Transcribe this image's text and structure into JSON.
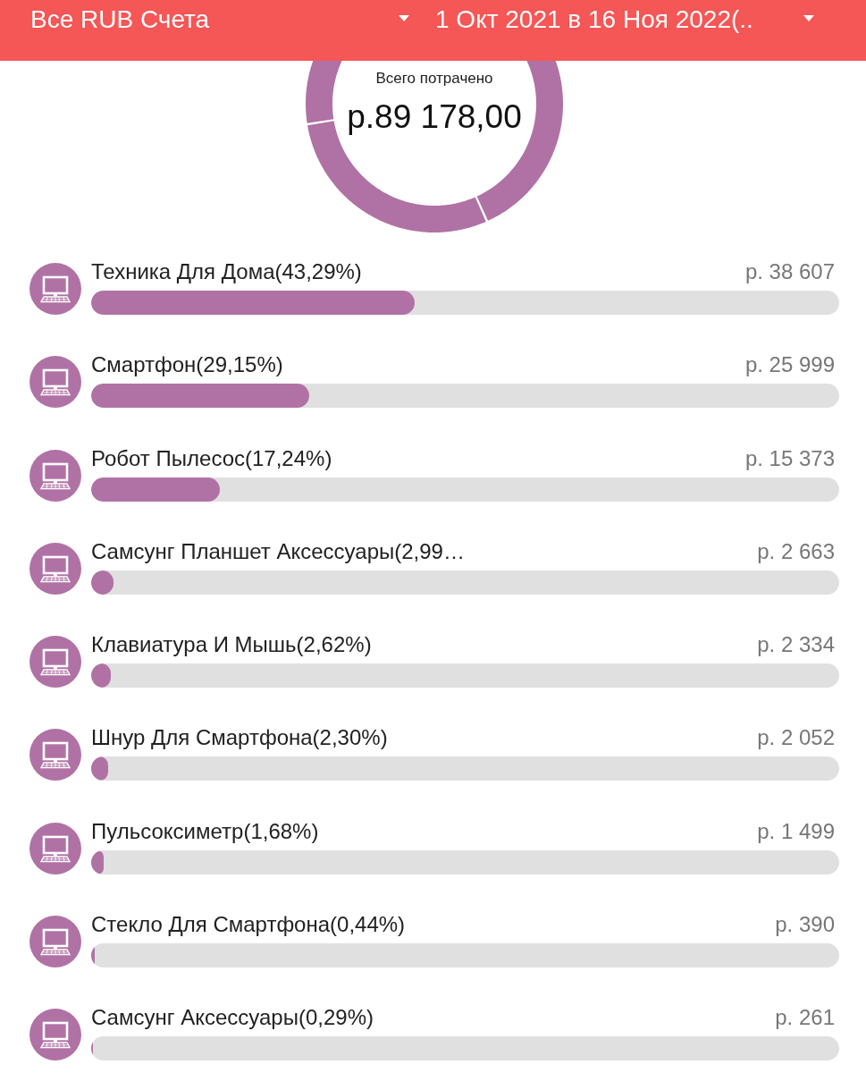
{
  "header": {
    "account_select": "Все RUB Счета",
    "period_select": "1 Окт 2021 в 16 Ноя 2022(.."
  },
  "summary": {
    "label": "Всего потрачено",
    "total": "р.89 178,00"
  },
  "categories": [
    {
      "title": "Техника Для Дома(43,29%)",
      "amount": "р. 38 607",
      "level": 0.4329
    },
    {
      "title": "Смартфон(29,15%)",
      "amount": "р. 25 999",
      "level": 0.2915
    },
    {
      "title": "Робот Пылесос(17,24%)",
      "amount": "р. 15 373",
      "level": 0.1724
    },
    {
      "title": "Самсунг Планшет Аксессуары(2,99…",
      "amount": "р. 2 663",
      "level": 0.0299
    },
    {
      "title": "Клавиатура И Мышь(2,62%)",
      "amount": "р. 2 334",
      "level": 0.0262
    },
    {
      "title": "Шнур Для Смартфона(2,30%)",
      "amount": "р. 2 052",
      "level": 0.023
    },
    {
      "title": "Пульсоксиметр(1,68%)",
      "amount": "р. 1 499",
      "level": 0.0168
    },
    {
      "title": "Стекло Для Смартфона(0,44%)",
      "amount": "р. 390",
      "level": 0.0044
    },
    {
      "title": "Самсунг Аксессуары(0,29%)",
      "amount": "р. 261",
      "level": 0.0029
    }
  ]
}
